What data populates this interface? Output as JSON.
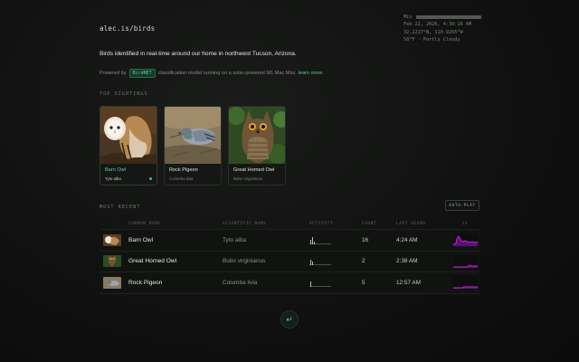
{
  "header": {
    "site_title": "alec.is/birds"
  },
  "status": {
    "mix_label": "Mix",
    "mix_level": 1.0,
    "datetime": "Feb 22, 2026, 4:30:16 AM",
    "coords": "32.2217°N, 110.9265°W",
    "weather": "58°F · Partly Cloudy"
  },
  "intro": {
    "text": "Birds identified in real-time around our home in northwest Tucson, Arizona.",
    "powered_prefix": "Powered by",
    "model_badge": "BirdNET",
    "powered_suffix": "classification model running on a solar-powered M1 Mac Mini.",
    "learn_more": "learn more."
  },
  "top_sightings": {
    "label": "Top Sightings",
    "cards": [
      {
        "name": "Barn Owl",
        "scientific": "Tyto alba",
        "selected": true
      },
      {
        "name": "Rock Pigeon",
        "scientific": "Columba livia",
        "selected": false
      },
      {
        "name": "Great Horned Owl",
        "scientific": "Bubo virginianus",
        "selected": false
      }
    ]
  },
  "most_recent": {
    "label": "Most Recent",
    "autoplay_label": "AUTO-PLAY",
    "columns": [
      "Common Name",
      "Scientific Name",
      "Activity",
      "Count",
      "Last Heard",
      "24"
    ],
    "rows": [
      {
        "common": "Barn Owl",
        "scientific": "Tyto alba",
        "count": "16",
        "last_heard": "4:24 AM",
        "activity": [
          0.55,
          0.9,
          0.35
        ]
      },
      {
        "common": "Great Horned Owl",
        "scientific": "Bubo virginianus",
        "count": "2",
        "last_heard": "2:38 AM",
        "activity": [
          0.7,
          0.5
        ]
      },
      {
        "common": "Rock Pigeon",
        "scientific": "Columba livia",
        "count": "5",
        "last_heard": "12:57 AM",
        "activity": [
          0.6
        ]
      }
    ]
  },
  "colors": {
    "accent": "#58c996",
    "spark": "#c026d3"
  },
  "footer": {
    "enter_icon": "return-icon"
  }
}
